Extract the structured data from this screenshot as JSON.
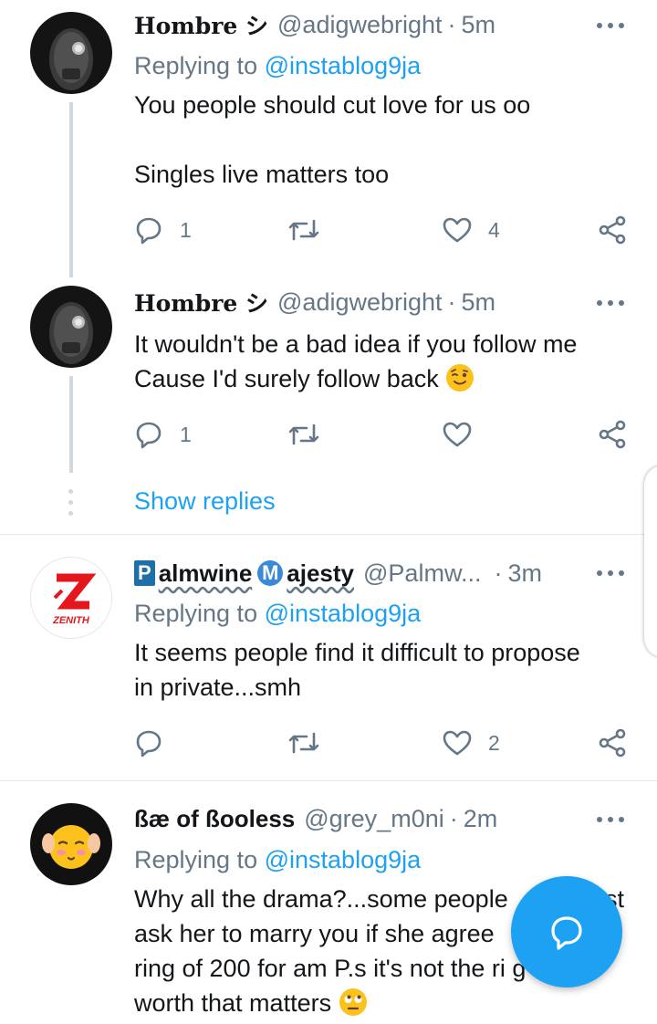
{
  "tweets": [
    {
      "name": "Hombre シ",
      "handle": "@adigwebright",
      "sep": "·",
      "time": "5m",
      "replying_label": "Replying to",
      "replying_handle": "@instablog9ja",
      "text_line1": "You people should cut love for us oo",
      "text_line2": "Singles live matters too",
      "replies": "1",
      "likes": "4"
    },
    {
      "name": "Hombre シ",
      "handle": "@adigwebright",
      "sep": "·",
      "time": "5m",
      "text_line1": "It wouldn't be a bad idea if you follow me",
      "text_line2": "Cause I'd surely follow back",
      "replies": "1",
      "likes": ""
    },
    {
      "name_badge1": "P",
      "name_part1": "almwine",
      "name_badge2": "M",
      "name_part2": "ajesty",
      "handle": "@Palmw...",
      "sep": "·",
      "time": "3m",
      "avatar_text": "ZENITH",
      "replying_label": "Replying to",
      "replying_handle": "@instablog9ja",
      "text_line1": "It seems people find it difficult to propose",
      "text_line2": "in private...smh",
      "replies": "",
      "likes": "2"
    },
    {
      "name": "ßæ of ßooless",
      "handle": "@grey_m0ni",
      "sep": "·",
      "time": "2m",
      "replying_label": "Replying to",
      "replying_handle": "@instablog9ja",
      "text_line1": "Why all the drama?...some people",
      "text_line1b": "st",
      "text_line2": "ask her to marry you if she agree",
      "text_line3": "ring of 200 for am P.s it's not the ri",
      "text_line3b": "g",
      "text_line4": "worth that matters"
    }
  ],
  "thread": {
    "show_replies": "Show replies"
  },
  "icons": {
    "reply": "reply-icon",
    "retweet": "retweet-icon",
    "like": "heart-icon",
    "share": "share-icon",
    "more": "more-icon",
    "compose": "compose-reply-icon"
  },
  "colors": {
    "accent": "#1da1f2",
    "muted": "#657786",
    "divider": "#e1e8ed"
  }
}
